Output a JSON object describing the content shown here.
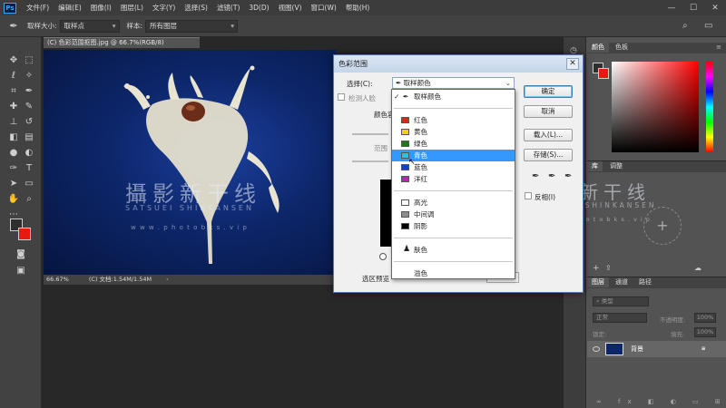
{
  "menubar": {
    "logo": "Ps",
    "items": [
      "文件(F)",
      "编辑(E)",
      "图像(I)",
      "图层(L)",
      "文字(Y)",
      "选择(S)",
      "滤镜(T)",
      "3D(D)",
      "视图(V)",
      "窗口(W)",
      "帮助(H)"
    ],
    "controls": [
      "—",
      "☐",
      "✕"
    ]
  },
  "options": {
    "sample_size_label": "取样大小:",
    "sample_size_value": "取样点",
    "sample_label": "样本:",
    "sample_value": "所有图层"
  },
  "document": {
    "tab_title": "(C) 色彩范围抠图.jpg @ 66.7%(RGB/8)",
    "zoom": "66.67%",
    "doc_info": "(C) 文档:1.54M/1.54M"
  },
  "watermark": {
    "line1": "攝影新干线",
    "line2": "SATSUEI SHINKANSEN",
    "line3": "w w w . p h o t o b k s . v i p"
  },
  "dialog": {
    "title": "色彩范围",
    "close": "✕",
    "select_label": "选择(C):",
    "select_value": "取样颜色",
    "detect_faces": "检测人脸",
    "color_tolerance": "颜色容差",
    "range": "范围",
    "selection_preview": "选区预览",
    "invert": "反相(I)",
    "buttons": {
      "ok": "确定",
      "cancel": "取消",
      "load": "载入(L)...",
      "save": "存储(S)..."
    }
  },
  "dropdown": {
    "items": [
      {
        "label": "取样颜色",
        "checked": true,
        "swatch": "eyedropper"
      },
      {
        "label": "红色",
        "swatch": "#d02d14"
      },
      {
        "label": "黄色",
        "swatch": "#f0d20a"
      },
      {
        "label": "绿色",
        "swatch": "#1e7a19"
      },
      {
        "label": "青色",
        "swatch": "#1ec8e6",
        "highlighted": true
      },
      {
        "label": "蓝色",
        "swatch": "#1441c8"
      },
      {
        "label": "洋红",
        "swatch": "#c81eb4"
      },
      {
        "label": "高光",
        "swatch": "#ffffff"
      },
      {
        "label": "中间调",
        "swatch": "#8c8c8c"
      },
      {
        "label": "阴影",
        "swatch": "#000000"
      },
      {
        "label": "肤色",
        "swatch": "person"
      },
      {
        "label": "溢色",
        "swatch": "none"
      }
    ]
  },
  "panels": {
    "color": {
      "tabs": [
        "颜色",
        "色板"
      ]
    },
    "nav": {
      "tabs": [
        "库",
        "调整"
      ]
    },
    "layers": {
      "tabs": [
        "图层",
        "通道",
        "路径"
      ],
      "kind_filter": "类型",
      "blend_mode": "正常",
      "opacity_label": "不透明度:",
      "opacity_value": "100%",
      "lock_label": "锁定:",
      "fill_label": "填充:",
      "fill_value": "100%",
      "layer_name": "背景"
    }
  },
  "colors": {
    "foreground": "#2e2e2e",
    "background": "#e8190f",
    "ps_blue": "#31a8ff",
    "highlight": "#3399ff"
  }
}
